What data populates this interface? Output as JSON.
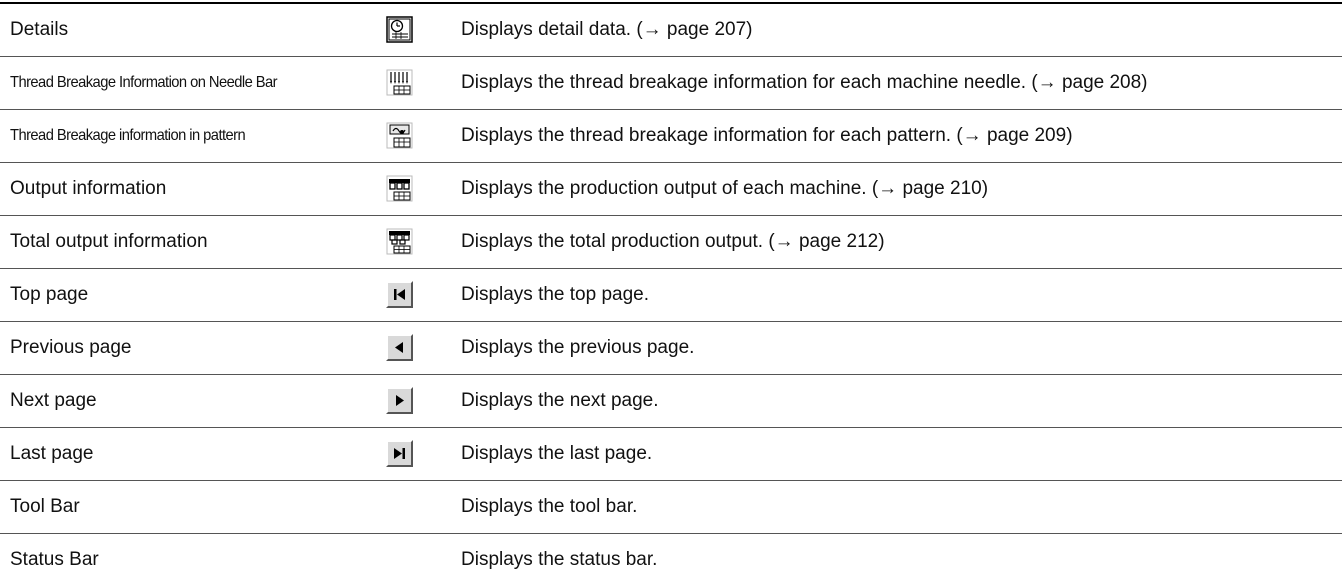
{
  "rows": [
    {
      "name": "Details",
      "icon": "details-clock-icon",
      "desc": "Displays detail data.  (→ page 207)"
    },
    {
      "name": "Thread Breakage Information on Needle Bar",
      "icon": "needle-bar-thread-icon",
      "desc": "Displays the thread breakage information for each machine needle. (→ page 208)"
    },
    {
      "name": "Thread Breakage information in pattern",
      "icon": "pattern-thread-icon",
      "desc": "Displays the thread breakage information for each pattern. (→ page 209)"
    },
    {
      "name": "Output information",
      "icon": "output-machines-icon",
      "desc": "Displays the production output of each machine. (→ page 210)"
    },
    {
      "name": "Total output information",
      "icon": "total-output-icon",
      "desc": "Displays the total production output. (→ page 212)"
    },
    {
      "name": "Top page",
      "icon": "first-page-icon",
      "desc": "Displays the top page."
    },
    {
      "name": "Previous page",
      "icon": "previous-page-icon",
      "desc": "Displays the previous page."
    },
    {
      "name": "Next page",
      "icon": "next-page-icon",
      "desc": "Displays the next page."
    },
    {
      "name": "Last page",
      "icon": "last-page-icon",
      "desc": "Displays the last page."
    },
    {
      "name": "Tool Bar",
      "icon": "",
      "desc": "Displays the tool bar."
    },
    {
      "name": "Status Bar",
      "icon": "",
      "desc": "Displays the status bar."
    }
  ]
}
